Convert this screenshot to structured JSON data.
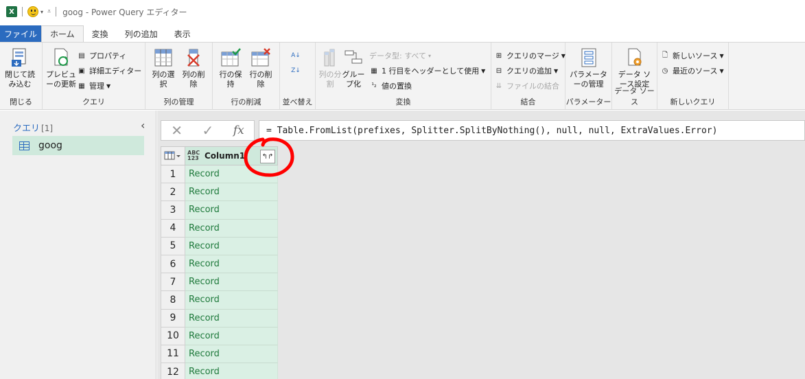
{
  "titlebar": {
    "title": "goog - Power Query エディター"
  },
  "tabs": [
    {
      "label": "ファイル"
    },
    {
      "label": "ホーム"
    },
    {
      "label": "変換"
    },
    {
      "label": "列の追加"
    },
    {
      "label": "表示"
    }
  ],
  "ribbon": {
    "close": {
      "btn": "閉じて読み込む",
      "label": "閉じる"
    },
    "query": {
      "preview": "プレビューの更新",
      "properties": "プロパティ",
      "advanced": "詳細エディター",
      "manage": "管理",
      "label": "クエリ"
    },
    "columns": {
      "choose": "列の選択",
      "remove": "列の削除",
      "label": "列の管理"
    },
    "rows": {
      "keep": "行の保持",
      "remove": "行の削除",
      "label": "行の削減"
    },
    "sort": {
      "label": "並べ替え"
    },
    "transform": {
      "split": "列の分割",
      "group": "グループ化",
      "datatype": "データ型: すべて",
      "firstrow": "1 行目をヘッダーとして使用",
      "replace": "値の置換",
      "label": "変換"
    },
    "combine": {
      "merge": "クエリのマージ",
      "append": "クエリの追加",
      "combine_files": "ファイルの結合",
      "label": "結合"
    },
    "params": {
      "btn": "パラメーターの管理",
      "label": "パラメーター"
    },
    "datasource": {
      "btn": "データ ソース設定",
      "label": "データ ソース"
    },
    "newquery": {
      "newsrc": "新しいソース",
      "recent": "最近のソース",
      "label": "新しいクエリ"
    }
  },
  "queries_panel": {
    "header": "クエリ",
    "count": "[1]",
    "items": [
      {
        "name": "goog"
      }
    ]
  },
  "formula": {
    "text": "= Table.FromList(prefixes, Splitter.SplitByNothing(), null, null, ExtraValues.Error)"
  },
  "table": {
    "type_label_top": "ABC",
    "type_label_bottom": "123",
    "column": "Column1",
    "rows": [
      {
        "n": "1",
        "v": "Record"
      },
      {
        "n": "2",
        "v": "Record"
      },
      {
        "n": "3",
        "v": "Record"
      },
      {
        "n": "4",
        "v": "Record"
      },
      {
        "n": "5",
        "v": "Record"
      },
      {
        "n": "6",
        "v": "Record"
      },
      {
        "n": "7",
        "v": "Record"
      },
      {
        "n": "8",
        "v": "Record"
      },
      {
        "n": "9",
        "v": "Record"
      },
      {
        "n": "10",
        "v": "Record"
      },
      {
        "n": "11",
        "v": "Record"
      },
      {
        "n": "12",
        "v": "Record"
      }
    ]
  },
  "colors": {
    "file_tab": "#2b6bbf",
    "selected": "#cfe9dc",
    "record_text": "#1f7a3c",
    "annotation": "#ff0000"
  }
}
